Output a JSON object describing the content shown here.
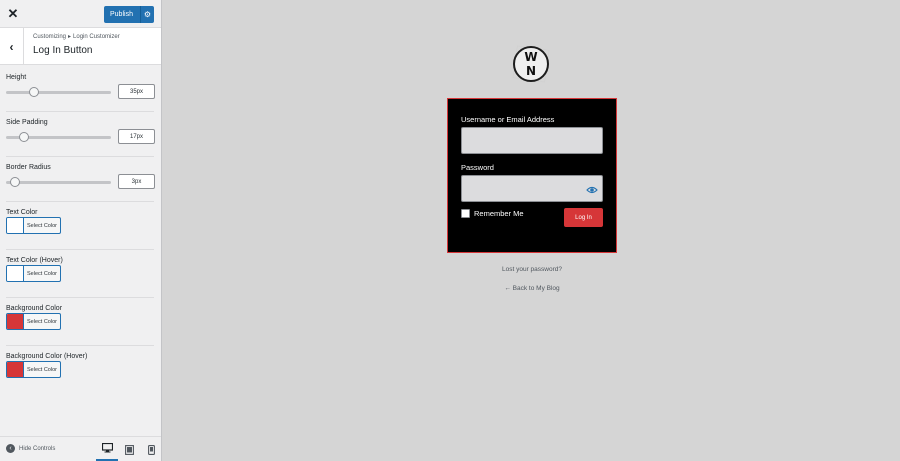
{
  "header": {
    "close_icon": "close-icon",
    "publish_label": "Publish",
    "publish_icon": "gear-icon"
  },
  "section": {
    "breadcrumb_root": "Customizing",
    "breadcrumb_sep": "▸",
    "breadcrumb_parent": "Login Customizer",
    "title": "Log In Button"
  },
  "controls": {
    "height": {
      "label": "Height",
      "value": "35px",
      "level": 0.27
    },
    "side_padding": {
      "label": "Side Padding",
      "value": "17px",
      "level": 0.17
    },
    "border_radius": {
      "label": "Border Radius",
      "value": "3px",
      "level": 0.09
    },
    "text_color": {
      "label": "Text Color",
      "button": "Select Color",
      "swatch": "#ffffff"
    },
    "text_color_hover": {
      "label": "Text Color (Hover)",
      "button": "Select Color",
      "swatch": "#ffffff"
    },
    "bg_color": {
      "label": "Background Color",
      "button": "Select Color",
      "swatch": "#d63638"
    },
    "bg_color_hover": {
      "label": "Background Color (Hover)",
      "button": "Select Color",
      "swatch": "#d63638"
    }
  },
  "footer": {
    "hide_controls": "Hide Controls",
    "devices": [
      "desktop-icon",
      "tablet-icon",
      "mobile-icon"
    ]
  },
  "preview": {
    "logo_text": "W N",
    "username_label": "Username or Email Address",
    "password_label": "Password",
    "remember_label": "Remember Me",
    "login_button": "Log In",
    "lost_password": "Lost your password?",
    "back_link": "← Back to My Blog"
  },
  "colors": {
    "accent": "#2271b1",
    "login_button_bg": "#d63638",
    "form_bg": "#000000"
  }
}
